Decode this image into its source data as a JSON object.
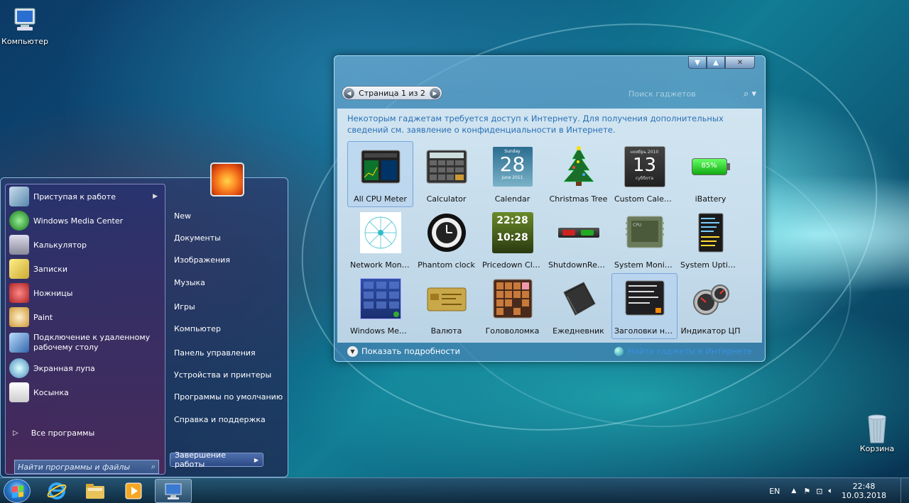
{
  "desktop": {
    "icons": [
      {
        "label": "Компьютер"
      },
      {
        "label": "Корзина"
      }
    ]
  },
  "gadgets_window": {
    "pager": "Страница 1 из 2",
    "search_placeholder": "Поиск гаджетов",
    "notice": "Некоторым гаджетам требуется доступ к Интернету. Для получения дополнительных сведений см. заявление о конфиденциальности в Интернете.",
    "items": [
      {
        "label": "All CPU Meter",
        "icon": "cpu-meter-icon"
      },
      {
        "label": "Calculator",
        "icon": "calculator-icon"
      },
      {
        "label": "Calendar",
        "icon": "calendar-icon",
        "day": "28",
        "weekday": "Sunday",
        "month": "june 2011"
      },
      {
        "label": "Christmas Tree",
        "icon": "christmas-tree-icon"
      },
      {
        "label": "Custom Calendar",
        "icon": "custom-calendar-icon",
        "day": "13",
        "header": "ноябрь 2010",
        "weekday": "суббота"
      },
      {
        "label": "iBattery",
        "icon": "battery-icon",
        "value": "85%"
      },
      {
        "label": "Network Monit...",
        "icon": "network-monitor-icon"
      },
      {
        "label": "Phantom clock",
        "icon": "phantom-clock-icon"
      },
      {
        "label": "Pricedown Clock",
        "icon": "pricedown-clock-icon",
        "time1": "22:28",
        "time2": "10:28"
      },
      {
        "label": "ShutdownRestart",
        "icon": "shutdown-restart-icon"
      },
      {
        "label": "System Monitor II",
        "icon": "system-monitor-icon"
      },
      {
        "label": "System Uptime ...",
        "icon": "system-uptime-icon"
      },
      {
        "label": "Windows Media...",
        "icon": "windows-media-icon"
      },
      {
        "label": "Валюта",
        "icon": "currency-icon"
      },
      {
        "label": "Головоломка",
        "icon": "puzzle-icon"
      },
      {
        "label": "Ежедневник",
        "icon": "diary-icon"
      },
      {
        "label": "Заголовки нов...",
        "icon": "news-headlines-icon"
      },
      {
        "label": "Индикатор ЦП",
        "icon": "cpu-indicator-icon"
      }
    ],
    "show_details": "Показать подробности",
    "find_online": "Найти гаджеты в Интернете"
  },
  "start_menu": {
    "programs": [
      {
        "label": "Приступая к работе",
        "has_arrow": true,
        "color": "#6fa8dc"
      },
      {
        "label": "Windows Media Center",
        "color": "#3a9a3a"
      },
      {
        "label": "Калькулятор",
        "color": "#7a8a9a"
      },
      {
        "label": "Записки",
        "color": "#e8d060"
      },
      {
        "label": "Ножницы",
        "color": "#c04040"
      },
      {
        "label": "Paint",
        "color": "#d8b060"
      },
      {
        "label": "Подключение к удаленному рабочему столу",
        "color": "#4a7ac0"
      },
      {
        "label": "Экранная лупа",
        "color": "#5a9ad0"
      },
      {
        "label": "Косынка",
        "color": "#d0d0d0"
      }
    ],
    "all_programs": "Все программы",
    "search_placeholder": "Найти программы и файлы",
    "right_items": [
      "New",
      "Документы",
      "Изображения",
      "Музыка",
      "Игры",
      "Компьютер",
      "Панель управления",
      "Устройства и принтеры",
      "Программы по умолчанию",
      "Справка и поддержка"
    ],
    "shutdown": "Завершение работы"
  },
  "taskbar": {
    "lang": "EN",
    "time": "22:48",
    "date": "10.03.2018"
  }
}
